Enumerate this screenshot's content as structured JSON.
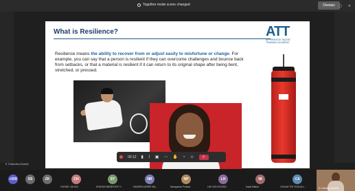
{
  "notification": {
    "text": "Together mode scene changed",
    "dismiss_label": "Dismiss"
  },
  "slide": {
    "title": "What is Resilience?",
    "logo": {
      "mark": "ATT",
      "tagline": "APPRENTICE TALENT TRAINING ACADEMY"
    },
    "body_prefix": "Resilience means ",
    "body_emphasis": "the ability to recover from or adjust easily to misfortune or change",
    "body_suffix": ". For example, you can say that a person is resilient if they can overcome challenges and bounce back from setbacks, or that a material is resilient if it can return to its original shape after being bent, stretched, or pressed."
  },
  "controls": {
    "timer": "00:12"
  },
  "presenter_label": "K Chandra (Guest)",
  "participants": [
    {
      "initials": "+209",
      "name": ""
    },
    {
      "initials": "SS",
      "name": ""
    },
    {
      "initials": "ZK",
      "name": ""
    },
    {
      "initials": "CH",
      "name": "CHONG JIA HUI"
    },
    {
      "initials": "SY",
      "name": "SHAZWI MENROS'E Y..."
    },
    {
      "initials": "NR",
      "name": "NAZIERA ARIEE MA..."
    },
    {
      "initials": "NP",
      "name": "Narayanan Prasad"
    },
    {
      "initials": "LH",
      "name": "LIM LEN HOONG"
    },
    {
      "initials": "IM",
      "name": "Izwal Miskor"
    },
    {
      "initials": "CA",
      "name": "CHUAH TRI YIGA ALL..."
    }
  ],
  "self_view_name": "K Chandra (Guest)",
  "colors": {
    "accent": "#5b5fc7",
    "title": "#1f3b6a",
    "emphasis": "#1f5fa6",
    "end_call": "#c4314b"
  }
}
